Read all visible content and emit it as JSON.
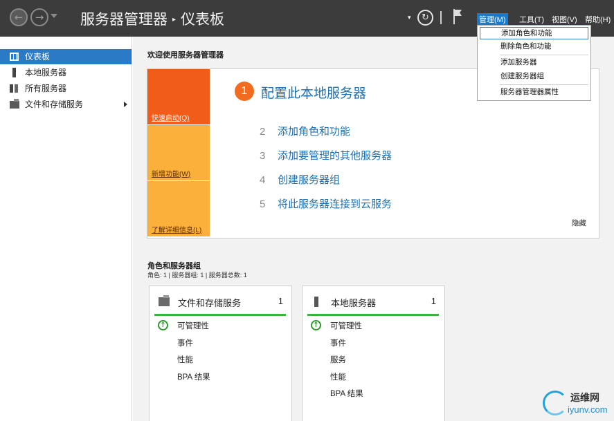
{
  "titlebar": {
    "title": "服务器管理器",
    "separator": "▸",
    "breadcrumb": "仪表板",
    "menus": [
      "管理(M)",
      "工具(T)",
      "视图(V)",
      "帮助(H)"
    ]
  },
  "manage_menu": {
    "items": [
      "添加角色和功能",
      "删除角色和功能",
      "添加服务器",
      "创建服务器组",
      "服务器管理器属性"
    ]
  },
  "sidebar": {
    "items": [
      {
        "label": "仪表板",
        "icon": "dashboard-icon"
      },
      {
        "label": "本地服务器",
        "icon": "server-icon"
      },
      {
        "label": "所有服务器",
        "icon": "servers-icon"
      },
      {
        "label": "文件和存储服务",
        "icon": "folder-icon"
      }
    ]
  },
  "main": {
    "welcome": "欢迎使用服务器管理器",
    "tiles": [
      "快速启动(Q)",
      "新增功能(W)",
      "了解详细信息(L)"
    ],
    "step1": {
      "num": "1",
      "label": "配置此本地服务器"
    },
    "steps": [
      {
        "num": "2",
        "label": "添加角色和功能"
      },
      {
        "num": "3",
        "label": "添加要管理的其他服务器"
      },
      {
        "num": "4",
        "label": "创建服务器组"
      },
      {
        "num": "5",
        "label": "将此服务器连接到云服务"
      }
    ],
    "hide": "隐藏",
    "roles_title": "角色和服务器组",
    "roles_summary": "角色: 1 | 服务器组: 1 | 服务器总数: 1",
    "cards": [
      {
        "name": "文件和存储服务",
        "count": "1",
        "rows": [
          "可管理性",
          "事件",
          "性能",
          "BPA 结果"
        ]
      },
      {
        "name": "本地服务器",
        "count": "1",
        "rows": [
          "可管理性",
          "事件",
          "服务",
          "性能",
          "BPA 结果"
        ]
      }
    ]
  },
  "watermark": {
    "cn": "运维网",
    "en": "iyunv.com"
  },
  "colors": {
    "accent": "#2a7ac6",
    "orange": "#f25c19",
    "amber": "#fbb03b",
    "green": "#3ab53a"
  }
}
